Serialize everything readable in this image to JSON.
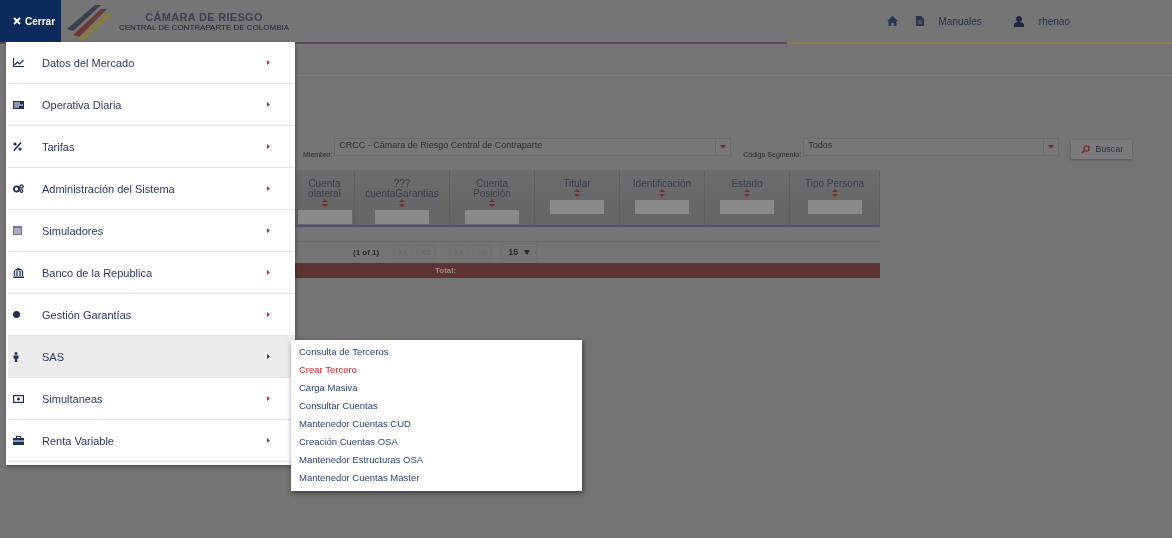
{
  "header": {
    "close_button": {
      "label": "Cerrar"
    },
    "logo": {
      "title": "CÁMARA DE RIESGO",
      "subtitle": "CENTRAL DE CONTRAPARTE DE COLOMBIA"
    },
    "manuals_link": "Manuales",
    "user_name": "rhenao"
  },
  "filters": [
    {
      "label": "Miembro:",
      "value": "CRCC - Cámara de Riesgo Central de Contraparte"
    },
    {
      "label": "Código Segmento:",
      "value": "Todos"
    }
  ],
  "search_button": "Buscar",
  "table": {
    "columns": [
      {
        "title_lines": [
          "Cuenta",
          "olateral"
        ],
        "sortable": true
      },
      {
        "title_lines": [
          "???",
          "cuentaGarantias"
        ],
        "sortable": true
      },
      {
        "title_lines": [
          "Cuenta",
          "Posición"
        ],
        "sortable": true
      },
      {
        "title_lines": [
          "Titular"
        ],
        "sortable": true
      },
      {
        "title_lines": [
          "Identificación"
        ],
        "sortable": true
      },
      {
        "title_lines": [
          "Estado"
        ],
        "sortable": true
      },
      {
        "title_lines": [
          "Tipo Persona"
        ],
        "sortable": true
      }
    ],
    "pagination": {
      "page_info": "(1 of 1)",
      "page_size": "15"
    },
    "footer": "Total:"
  },
  "menu": {
    "items": [
      {
        "label": "Datos del Mercado",
        "selected": false
      },
      {
        "label": "Operativa Diaria",
        "selected": false
      },
      {
        "label": "Tarifas",
        "selected": false
      },
      {
        "label": "Administración del Sistema",
        "selected": false
      },
      {
        "label": "Simuladores",
        "selected": false
      },
      {
        "label": "Banco de la Republica",
        "selected": false
      },
      {
        "label": "Gestión Garantías",
        "selected": false
      },
      {
        "label": "SAS",
        "selected": true
      },
      {
        "label": "Simultaneas",
        "selected": false
      },
      {
        "label": "Renta Variable",
        "selected": false
      }
    ]
  },
  "submenu": {
    "items": [
      {
        "label": "Consulta de Terceros",
        "selected": false
      },
      {
        "label": "Crear Tercero",
        "selected": true
      },
      {
        "label": "Carga Masiva",
        "selected": false
      },
      {
        "label": "Consultar Cuentas",
        "selected": false
      },
      {
        "label": "Mantenedor Cuentas CUD",
        "selected": false
      },
      {
        "label": "Creación Cuentas OSA",
        "selected": false
      },
      {
        "label": "Mantenedor Estructuras OSA",
        "selected": false
      },
      {
        "label": "Mantenedor Cuentas Master",
        "selected": false
      }
    ]
  }
}
